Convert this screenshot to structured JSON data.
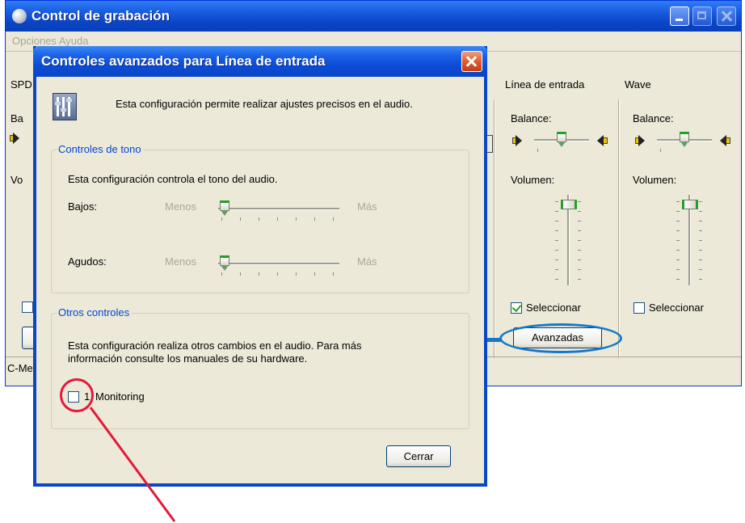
{
  "background_window": {
    "title": "Control de grabación",
    "menu_text": "Opciones  Ayuda",
    "status_text": "C-Me",
    "partial_labels": {
      "spd": "SPD",
      "ba": "Ba",
      "vo": "Vo"
    },
    "channels": [
      {
        "name": "Línea de entrada",
        "balance_label": "Balance:",
        "volume_label": "Volumen:",
        "select_label": "Seleccionar",
        "selected": true,
        "balance": 0.5,
        "volume": 0.9,
        "advanced_label": "Avanzadas"
      },
      {
        "name": "Wave",
        "balance_label": "Balance:",
        "volume_label": "Volumen:",
        "select_label": "Seleccionar",
        "selected": false,
        "balance": 0.5,
        "volume": 0.9
      }
    ]
  },
  "dialog": {
    "title": "Controles avanzados para Línea de entrada",
    "description": "Esta configuración permite realizar ajustes precisos en el audio.",
    "tone_group": {
      "legend": "Controles de tono",
      "description": "Esta configuración controla el tono del audio.",
      "bass_label": "Bajos:",
      "treble_label": "Agudos:",
      "less_label": "Menos",
      "more_label": "Más",
      "bass_value": 0,
      "treble_value": 0
    },
    "other_group": {
      "legend": "Otros controles",
      "description_line1": "Esta configuración realiza otros cambios en el audio. Para más",
      "description_line2": "información consulte los manuales de su hardware.",
      "checkbox_prefix": "1",
      "checkbox_label": "Monitoring",
      "checked": false
    },
    "close_button_label": "Cerrar"
  },
  "annotations": {
    "blue_highlight_color": "#1577c9",
    "red_highlight_color": "#e31a3a"
  }
}
